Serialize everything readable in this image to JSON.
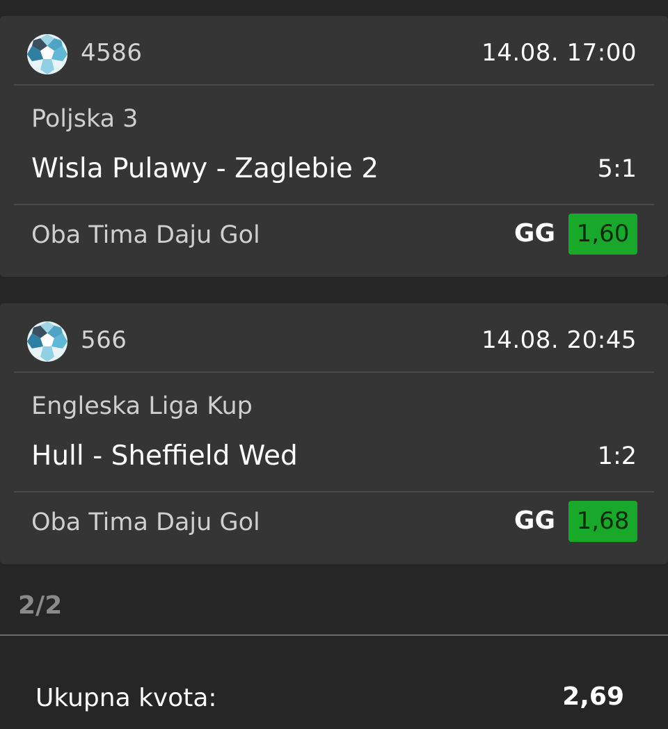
{
  "bets": [
    {
      "sport_icon": "soccer-ball-icon",
      "match_id": "4586",
      "datetime": "14.08. 17:00",
      "league": "Poljska 3",
      "teams": "Wisla Pulawy - Zaglebie 2",
      "score": "5:1",
      "market": "Oba Tima Daju Gol",
      "pick": "GG",
      "odd": "1,60"
    },
    {
      "sport_icon": "soccer-ball-icon",
      "match_id": "566",
      "datetime": "14.08. 20:45",
      "league": "Engleska Liga Kup",
      "teams": "Hull - Sheffield Wed",
      "score": "1:2",
      "market": "Oba Tima Daju Gol",
      "pick": "GG",
      "odd": "1,68"
    }
  ],
  "pager": "2/2",
  "total": {
    "label": "Ukupna kvota:",
    "value": "2,69"
  },
  "colors": {
    "background": "#262626",
    "card": "#353535",
    "odd_win": "#18a82a"
  }
}
